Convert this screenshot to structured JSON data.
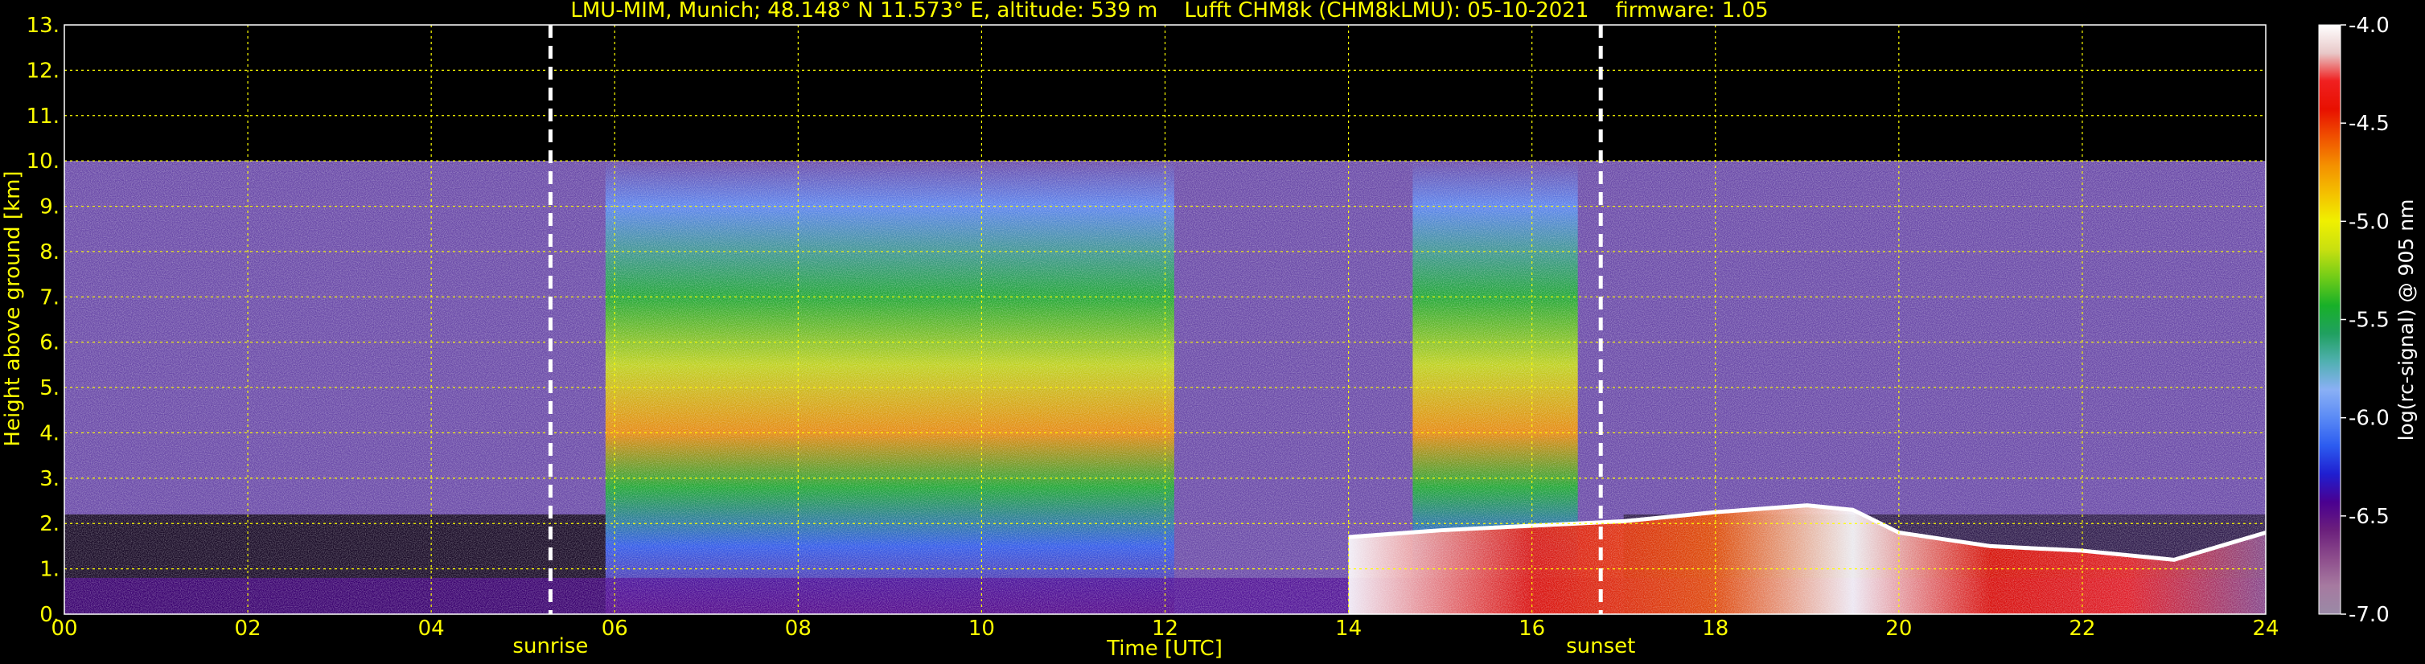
{
  "chart_data": {
    "type": "heatmap",
    "title": "LMU-MIM, Munich; 48.148° N 11.573° E, altitude: 539 m    Lufft CHM8k (CHM8kLMU): 05-10-2021    firmware: 1.05",
    "xlabel": "Time [UTC]",
    "ylabel": "Height above ground [km]",
    "xlim": [
      0,
      24
    ],
    "ylim": [
      0,
      13
    ],
    "x_ticks": [
      "00",
      "02",
      "04",
      "06",
      "08",
      "10",
      "12",
      "14",
      "16",
      "18",
      "20",
      "22",
      "24"
    ],
    "y_ticks": [
      "0.",
      "1.",
      "2.",
      "3.",
      "4.",
      "5.",
      "6.",
      "7.",
      "8.",
      "9.",
      "10.",
      "11.",
      "12.",
      "13."
    ],
    "grid": true,
    "data_top_km": 10,
    "markers": [
      {
        "label": "sunrise",
        "time_h": 5.3
      },
      {
        "label": "sunset",
        "time_h": 16.75
      }
    ],
    "colorbar": {
      "label": "log(rc-signal) @ 905 nm",
      "range": [
        -7.0,
        -4.0
      ],
      "ticks": [
        "-4.0",
        "-4.5",
        "-5.0",
        "-5.5",
        "-6.0",
        "-6.5",
        "-7.0"
      ],
      "colors": [
        "#9a8aa6",
        "#a67aa0",
        "#8d4d8c",
        "#6b1f7c",
        "#4a0090",
        "#1f1fd0",
        "#2c5cf0",
        "#5a8af5",
        "#8ab0f5",
        "#50b0b0",
        "#20a060",
        "#18b028",
        "#70cc18",
        "#c8e010",
        "#f0f000",
        "#f4c000",
        "#f49000",
        "#f05000",
        "#e81000",
        "#f02020",
        "#e8c8c8",
        "#ffffff"
      ]
    },
    "high_signal_periods_h": [
      [
        5.9,
        12.1
      ],
      [
        14.7,
        16.5
      ]
    ],
    "cloud_base_km": {
      "times_h": [
        14.0,
        15.0,
        16.0,
        17.0,
        18.0,
        19.0,
        19.5,
        20.0,
        21.0,
        22.0,
        23.0,
        24.0
      ],
      "heights_km": [
        1.7,
        1.85,
        1.95,
        2.05,
        2.25,
        2.4,
        2.3,
        1.8,
        1.5,
        1.4,
        1.2,
        1.8
      ]
    }
  }
}
